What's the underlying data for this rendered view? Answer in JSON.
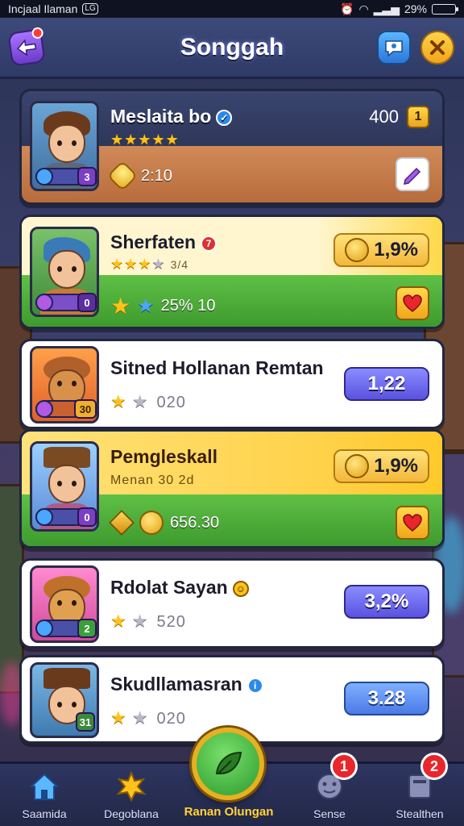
{
  "status_bar": {
    "carrier": "Incjaal Ilaman",
    "badge": "LG",
    "battery": "29%"
  },
  "header": {
    "title": "Songgah",
    "back_icon": "back-arrow-icon",
    "chat_icon": "chat-icon",
    "close_icon": "close-icon"
  },
  "players": [
    {
      "name": "Meslaita bo",
      "verified": "✓",
      "stars_on": "★★★★★",
      "stars_off": "",
      "score": "400",
      "rank": "1",
      "stat_value": "2:10",
      "level": "3",
      "action_icon": "pencil-icon",
      "theme": "dark"
    },
    {
      "name": "Sherfaten",
      "verified": "7",
      "stars_on": "★★★",
      "stars_off": "★",
      "stars_text": "3/4",
      "pill_value": "1,9%",
      "stat_value": "25% 10",
      "level": "0",
      "action_icon": "heart-icon",
      "theme": "gold-green"
    },
    {
      "name": "Sitned Hollanan Remtan",
      "stars_on": "★",
      "stars_off": "★",
      "stat_value": "020",
      "pill_value": "1,22",
      "level": "30",
      "theme": "white"
    },
    {
      "name": "Pemgleskall",
      "subtitle": "Menan 30 2d",
      "stat_value": "656.30",
      "pill_value": "1,9%",
      "level": "0",
      "action_icon": "heart-icon",
      "theme": "gold-green"
    },
    {
      "name": "Rdolat Sayan",
      "verified": "☺",
      "stars_on": "★",
      "stars_off": "★",
      "stat_value": "520",
      "pill_value": "3,2%",
      "level": "2",
      "theme": "white"
    },
    {
      "name": "Skudllamasran",
      "verified": "i",
      "stars_on": "★",
      "stars_off": "★",
      "stat_value": "020",
      "pill_value": "3.28",
      "level": "31",
      "theme": "white"
    }
  ],
  "nav": {
    "items": [
      {
        "label": "Saamida",
        "icon": "home-icon"
      },
      {
        "label": "Degoblana",
        "icon": "star-burst-icon"
      },
      {
        "label": "Sense",
        "icon": "face-icon",
        "badge": "1"
      },
      {
        "label": "Stealthen",
        "icon": "book-icon",
        "badge": "2"
      }
    ],
    "center_label": "Ranan Olungan",
    "center_icon": "leaf-icon"
  },
  "colors": {
    "gold": "#f3b73a",
    "green": "#4caf3a",
    "purple": "#5a52e0",
    "blue": "#4a7ae6",
    "dark_card": "#2e3758",
    "brown": "#c7794a"
  }
}
